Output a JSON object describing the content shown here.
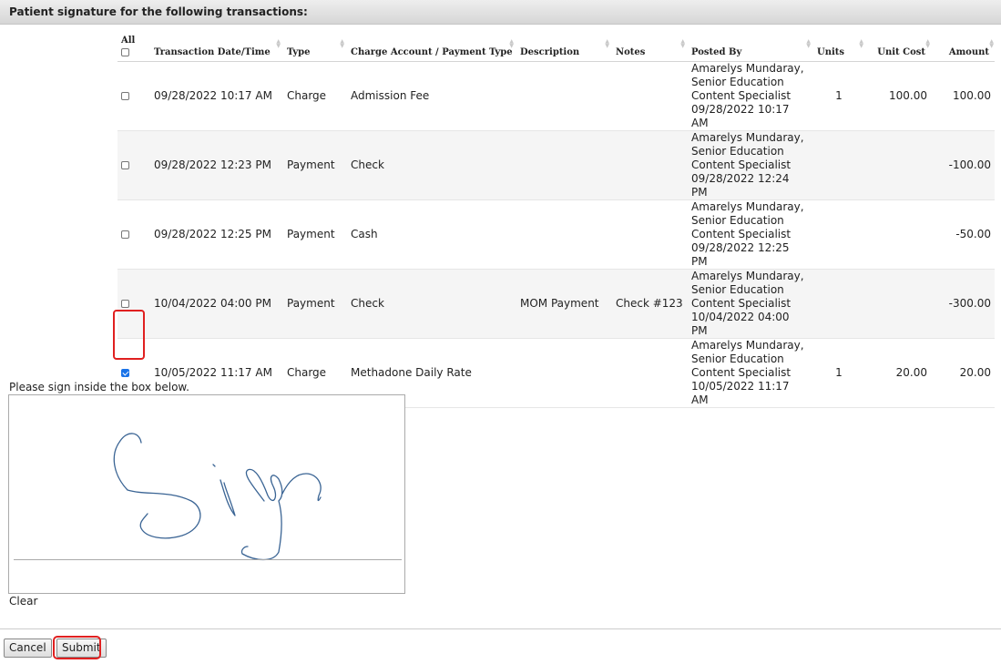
{
  "header": {
    "title": "Patient signature for the following transactions:"
  },
  "table": {
    "columns": {
      "all": "All",
      "datetime": "Transaction Date/Time",
      "type": "Type",
      "account": "Charge Account / Payment Type",
      "description": "Description",
      "notes": "Notes",
      "posted_by": "Posted By",
      "units": "Units",
      "unit_cost": "Unit Cost",
      "amount": "Amount"
    },
    "rows": [
      {
        "checked": false,
        "datetime": "09/28/2022 10:17 AM",
        "type": "Charge",
        "account": "Admission Fee",
        "description": "",
        "notes": "",
        "posted_name": "Amarelys Mundaray,",
        "posted_title1": "Senior Education",
        "posted_title2": "Content Specialist",
        "posted_time": "09/28/2022 10:17 AM",
        "units": "1",
        "unit_cost": "100.00",
        "amount": "100.00"
      },
      {
        "checked": false,
        "datetime": "09/28/2022 12:23 PM",
        "type": "Payment",
        "account": "Check",
        "description": "",
        "notes": "",
        "posted_name": "Amarelys Mundaray,",
        "posted_title1": "Senior Education",
        "posted_title2": "Content Specialist",
        "posted_time": "09/28/2022 12:24 PM",
        "units": "",
        "unit_cost": "",
        "amount": "-100.00"
      },
      {
        "checked": false,
        "datetime": "09/28/2022 12:25 PM",
        "type": "Payment",
        "account": "Cash",
        "description": "",
        "notes": "",
        "posted_name": "Amarelys Mundaray,",
        "posted_title1": "Senior Education",
        "posted_title2": "Content Specialist",
        "posted_time": "09/28/2022 12:25 PM",
        "units": "",
        "unit_cost": "",
        "amount": "-50.00"
      },
      {
        "checked": false,
        "datetime": "10/04/2022 04:00 PM",
        "type": "Payment",
        "account": "Check",
        "description": "MOM Payment",
        "notes": "Check #123",
        "posted_name": "Amarelys Mundaray,",
        "posted_title1": "Senior Education",
        "posted_title2": "Content Specialist",
        "posted_time": "10/04/2022 04:00 PM",
        "units": "",
        "unit_cost": "",
        "amount": "-300.00"
      },
      {
        "checked": true,
        "datetime": "10/05/2022 11:17 AM",
        "type": "Charge",
        "account": "Methadone Daily Rate",
        "description": "",
        "notes": "",
        "posted_name": "Amarelys Mundaray,",
        "posted_title1": "Senior Education",
        "posted_title2": "Content Specialist",
        "posted_time": "10/05/2022 11:17 AM",
        "units": "1",
        "unit_cost": "20.00",
        "amount": "20.00"
      }
    ]
  },
  "signature": {
    "instruction": "Please sign inside the box below.",
    "clear_label": "Clear",
    "stroke_color": "#3a6494"
  },
  "footer": {
    "cancel_label": "Cancel",
    "submit_label": "Submit"
  },
  "colors": {
    "highlight": "#e02020",
    "checkbox_checked": "#1a73e8"
  }
}
